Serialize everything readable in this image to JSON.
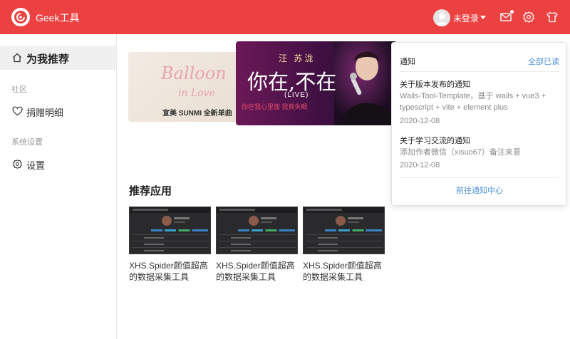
{
  "header": {
    "app_title": "Geek工具",
    "login_label": "未登录",
    "icons": [
      "app-logo-icon",
      "avatar-icon",
      "mail-icon",
      "settings-gear-icon",
      "skin-shirt-icon"
    ],
    "accent_color": "#ec4141"
  },
  "sidebar": {
    "recommend_label": "为我推荐",
    "community_group": "社区",
    "donation_label": "捐赠明细",
    "settings_group": "系统设置",
    "settings_label": "设置"
  },
  "banners": {
    "left_script": "Balloon",
    "left_script2": "in Love",
    "left_caption": "宣美 SUNMI 全新单曲",
    "main_singer": "汪 苏泷",
    "main_song": "你在,不在",
    "main_live": "(LIVE)",
    "main_tag": "你在我心里面 我真失眠"
  },
  "main": {
    "section_title": "推荐应用",
    "apps": [
      {
        "label": "XHS.Spider颜值超高的数据采集工具"
      },
      {
        "label": "XHS.Spider颜值超高的数据采集工具"
      },
      {
        "label": "XHS.Spider颜值超高的数据采集工具"
      }
    ]
  },
  "notifications": {
    "title": "通知",
    "read_all": "全部已读",
    "items": [
      {
        "title": "关于版本发布的通知",
        "body": "Wails-Tool-Template，基于 wails + vue3 + typescript + vite + element plus",
        "date": "2020-12-08"
      },
      {
        "title": "关于学习交流的通知",
        "body": "添加作者微信（xisuo67）备注来意",
        "date": "2020-12-08"
      }
    ],
    "center_link": "前往通知中心",
    "link_color": "#4a90d9"
  }
}
